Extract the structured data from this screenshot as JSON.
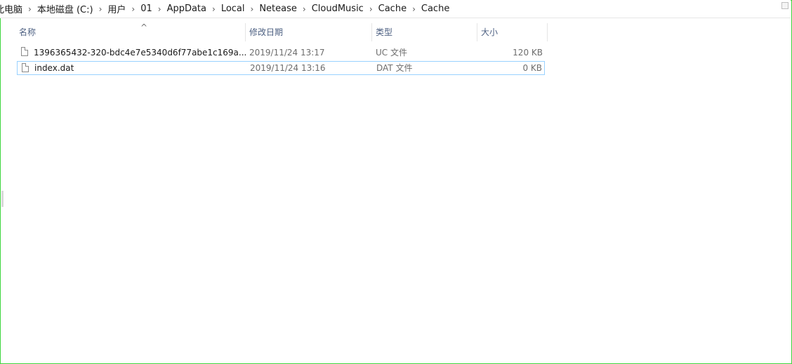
{
  "breadcrumb": [
    "此电脑",
    "本地磁盘 (C:)",
    "用户",
    "01",
    "AppData",
    "Local",
    "Netease",
    "CloudMusic",
    "Cache",
    "Cache"
  ],
  "columns": {
    "name": "名称",
    "modified": "修改日期",
    "type": "类型",
    "size": "大小"
  },
  "files": [
    {
      "name": "1396365432-320-bdc4e7e5340d6f77abe1c169a...",
      "modified": "2019/11/24 13:17",
      "type": "UC 文件",
      "size": "120 KB"
    },
    {
      "name": "index.dat",
      "modified": "2019/11/24 13:16",
      "type": "DAT 文件",
      "size": "0 KB"
    }
  ],
  "icons": {
    "sort": "sort-ascending-icon",
    "file": "file-icon",
    "separator": "chevron-right-icon"
  },
  "colors": {
    "border": "#3fd63f",
    "selection": "#99d1ff",
    "header_text": "#4d6082"
  }
}
